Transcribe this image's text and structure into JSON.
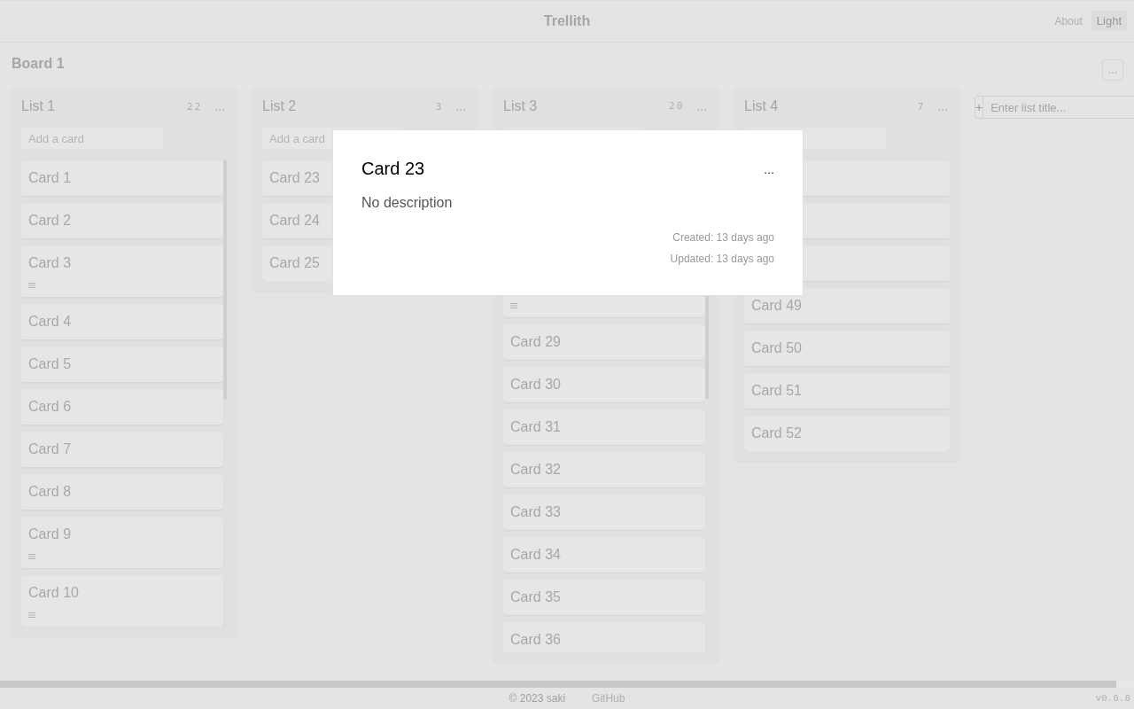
{
  "header": {
    "title": "Trellith",
    "links": [
      {
        "label": "About"
      }
    ],
    "theme_button": "Light"
  },
  "board": {
    "title": "Board 1",
    "menu": "..."
  },
  "lists": [
    {
      "title": "List 1",
      "count": "22",
      "menu": "...",
      "add_placeholder": "Add a card",
      "scrollbar": true,
      "cards": [
        {
          "title": "Card 1",
          "has_description": false
        },
        {
          "title": "Card 2",
          "has_description": false
        },
        {
          "title": "Card 3",
          "has_description": true
        },
        {
          "title": "Card 4",
          "has_description": false
        },
        {
          "title": "Card 5",
          "has_description": false
        },
        {
          "title": "Card 6",
          "has_description": false
        },
        {
          "title": "Card 7",
          "has_description": false
        },
        {
          "title": "Card 8",
          "has_description": false
        },
        {
          "title": "Card 9",
          "has_description": true
        },
        {
          "title": "Card 10",
          "has_description": true
        }
      ]
    },
    {
      "title": "List 2",
      "count": "3",
      "menu": "...",
      "add_placeholder": "Add a card",
      "cards": [
        {
          "title": "Card 23",
          "has_description": false
        },
        {
          "title": "Card 24",
          "has_description": false
        },
        {
          "title": "Card 25",
          "has_description": false
        }
      ]
    },
    {
      "title": "List 3",
      "count": "20",
      "menu": "...",
      "scrollbar": true,
      "cards": [
        {
          "kind": "hidden"
        },
        {
          "kind": "hidden"
        },
        {
          "kind": "hidden"
        },
        {
          "kind": "card",
          "has_description": true
        },
        {
          "title": "Card 29",
          "has_description": false
        },
        {
          "title": "Card 30",
          "has_description": false
        },
        {
          "title": "Card 31",
          "has_description": false
        },
        {
          "title": "Card 32",
          "has_description": false
        },
        {
          "title": "Card 33",
          "has_description": false
        },
        {
          "title": "Card 34",
          "has_description": false
        },
        {
          "title": "Card 35",
          "has_description": false
        },
        {
          "title": "Card 36",
          "has_description": false
        }
      ]
    },
    {
      "title": "List 4",
      "count": "7",
      "menu": "...",
      "cards": [
        {
          "kind": "blank"
        },
        {
          "kind": "blank"
        },
        {
          "kind": "blank"
        },
        {
          "title": "Card 49",
          "has_description": false
        },
        {
          "title": "Card 50",
          "has_description": false
        },
        {
          "title": "Card 51",
          "has_description": false
        },
        {
          "title": "Card 52",
          "has_description": false
        }
      ]
    }
  ],
  "add_list": {
    "button": "+",
    "placeholder": "Enter list title..."
  },
  "modal": {
    "title": "Card 23",
    "menu": "...",
    "description": "No description",
    "created": "Created: 13 days ago",
    "updated": "Updated: 13 days ago"
  },
  "footer": {
    "copyright": "© 2023 saki",
    "link": "GitHub",
    "version": "v0.6.8"
  }
}
